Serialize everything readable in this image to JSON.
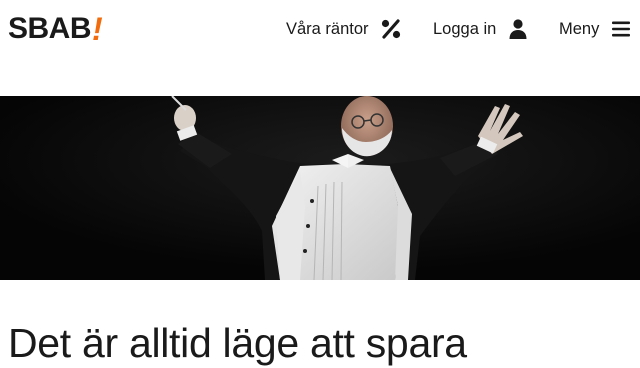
{
  "header": {
    "logo": {
      "text": "SBAB",
      "mark": "!",
      "mark_color": "#f26c0d"
    },
    "nav": [
      {
        "label": "Våra räntor",
        "icon": "percent-icon"
      },
      {
        "label": "Logga in",
        "icon": "user-icon"
      },
      {
        "label": "Meny",
        "icon": "hamburger-menu-icon"
      }
    ]
  },
  "hero": {
    "image": "photo of an orchestra conductor in white tie with arms raised against a black background"
  },
  "main": {
    "headline": "Det är alltid läge att spara"
  },
  "colors": {
    "brand_accent": "#f26c0d",
    "text": "#1a1a1a",
    "hero_background": "#0b0b0b"
  }
}
